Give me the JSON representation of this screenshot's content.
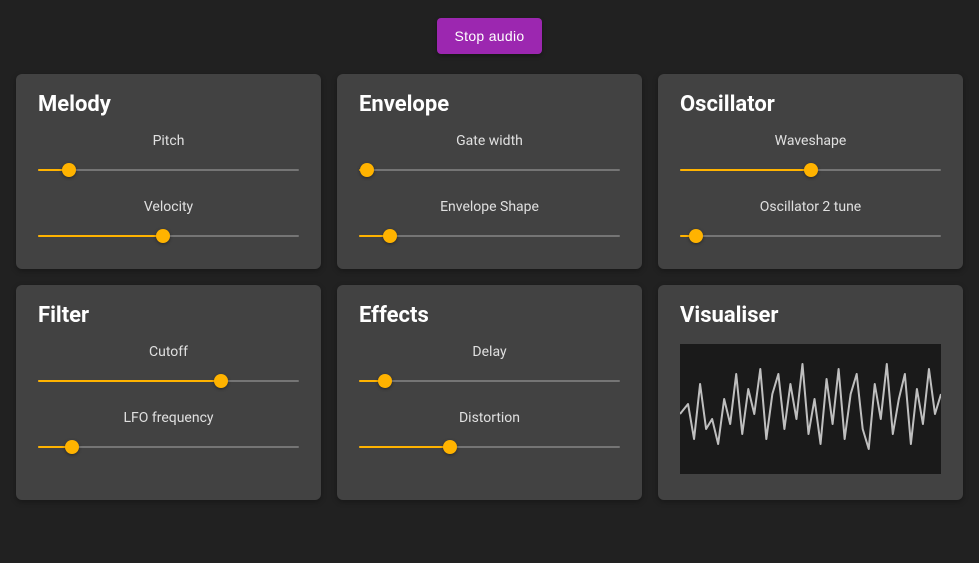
{
  "topbar": {
    "stop_label": "Stop audio"
  },
  "cards": {
    "melody": {
      "title": "Melody",
      "controls": [
        {
          "label": "Pitch",
          "value": 12
        },
        {
          "label": "Velocity",
          "value": 48
        }
      ]
    },
    "envelope": {
      "title": "Envelope",
      "controls": [
        {
          "label": "Gate width",
          "value": 3
        },
        {
          "label": "Envelope Shape",
          "value": 12
        }
      ]
    },
    "oscillator": {
      "title": "Oscillator",
      "controls": [
        {
          "label": "Waveshape",
          "value": 50
        },
        {
          "label": "Oscillator 2 tune",
          "value": 6
        }
      ]
    },
    "filter": {
      "title": "Filter",
      "controls": [
        {
          "label": "Cutoff",
          "value": 70
        },
        {
          "label": "LFO frequency",
          "value": 13
        }
      ]
    },
    "effects": {
      "title": "Effects",
      "controls": [
        {
          "label": "Delay",
          "value": 10
        },
        {
          "label": "Distortion",
          "value": 35
        }
      ]
    },
    "visualiser": {
      "title": "Visualiser"
    }
  },
  "colors": {
    "accent": "#ffb300",
    "primary_button": "#9c27b0",
    "card_bg": "#424242",
    "page_bg": "#212121"
  }
}
